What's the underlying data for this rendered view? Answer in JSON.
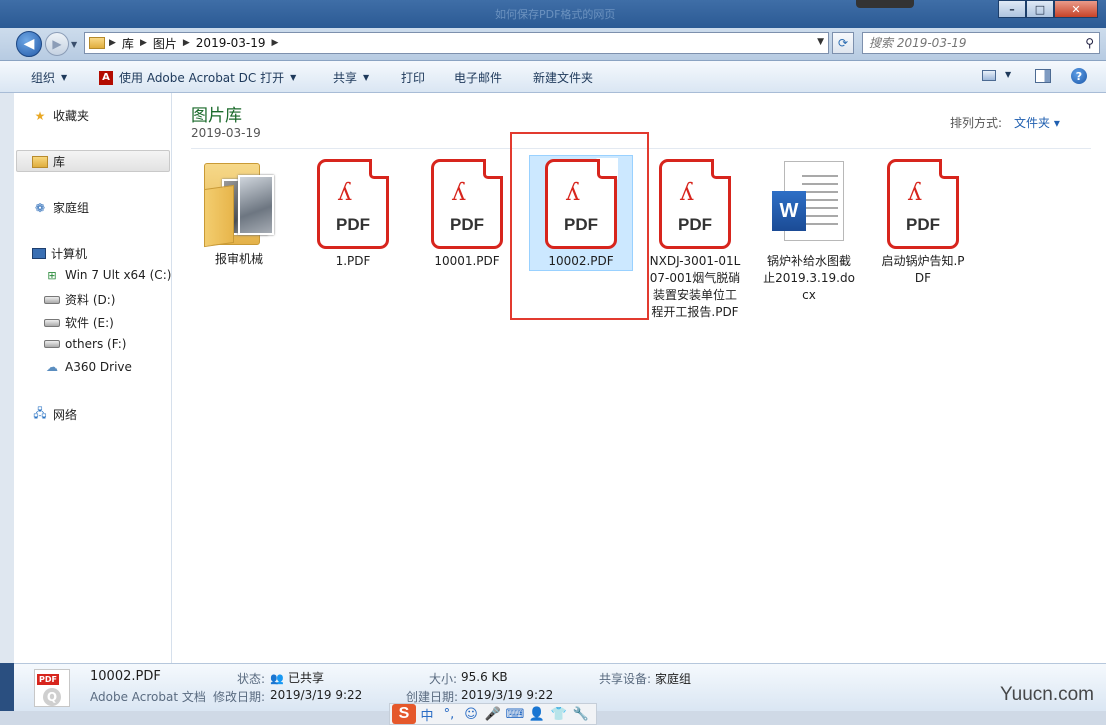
{
  "window": {
    "title": "如何保存PDF格式的网页",
    "controls": [
      "minimize",
      "maximize",
      "close"
    ]
  },
  "nav": {
    "breadcrumbs": [
      "库",
      "图片",
      "2019-03-19"
    ],
    "search_placeholder": "搜索 2019-03-19"
  },
  "toolbar": {
    "organize": "组织",
    "open_with": "使用 Adobe Acrobat DC 打开",
    "share": "共享",
    "print": "打印",
    "email": "电子邮件",
    "new_folder": "新建文件夹"
  },
  "sidebar": {
    "favorites": "收藏夹",
    "libraries": "库",
    "homegroup": "家庭组",
    "computer": "计算机",
    "drives": [
      "Win 7 Ult x64 (C:)",
      "资料 (D:)",
      "软件 (E:)",
      "others (F:)",
      "A360 Drive"
    ],
    "network": "网络"
  },
  "content": {
    "library_title": "图片库",
    "library_subtitle": "2019-03-19",
    "arrange_label": "排列方式:",
    "arrange_value": "文件夹",
    "files": [
      {
        "name": "报审机械",
        "type": "folder"
      },
      {
        "name": "1.PDF",
        "type": "pdf"
      },
      {
        "name": "10001.PDF",
        "type": "pdf"
      },
      {
        "name": "10002.PDF",
        "type": "pdf",
        "selected": true
      },
      {
        "name": "NXDJ-3001-01L07-001烟气脱硝装置安装单位工程开工报告.PDF",
        "type": "pdf"
      },
      {
        "name": "锅炉补给水图截止2019.3.19.docx",
        "type": "docx"
      },
      {
        "name": "启动锅炉告知.PDF",
        "type": "pdf"
      }
    ],
    "pdf_icon_text": "PDF",
    "word_icon_text": "W"
  },
  "details": {
    "file_name": "10002.PDF",
    "file_type": "Adobe Acrobat 文档",
    "status_label": "状态:",
    "status_value": "已共享",
    "size_label": "大小:",
    "size_value": "95.6 KB",
    "share_label": "共享设备:",
    "share_value": "家庭组",
    "modified_label": "修改日期:",
    "modified_value": "2019/3/19 9:22",
    "created_label": "创建日期:",
    "created_value": "2019/3/19 9:22",
    "icon_band": "PDF"
  },
  "ime": {
    "logo": "S",
    "mode": "中"
  },
  "watermark": "Yuucn.com",
  "colors": {
    "highlight": "#e23a2f",
    "selection": "#cce8ff",
    "pdf_red": "#d7251d"
  }
}
